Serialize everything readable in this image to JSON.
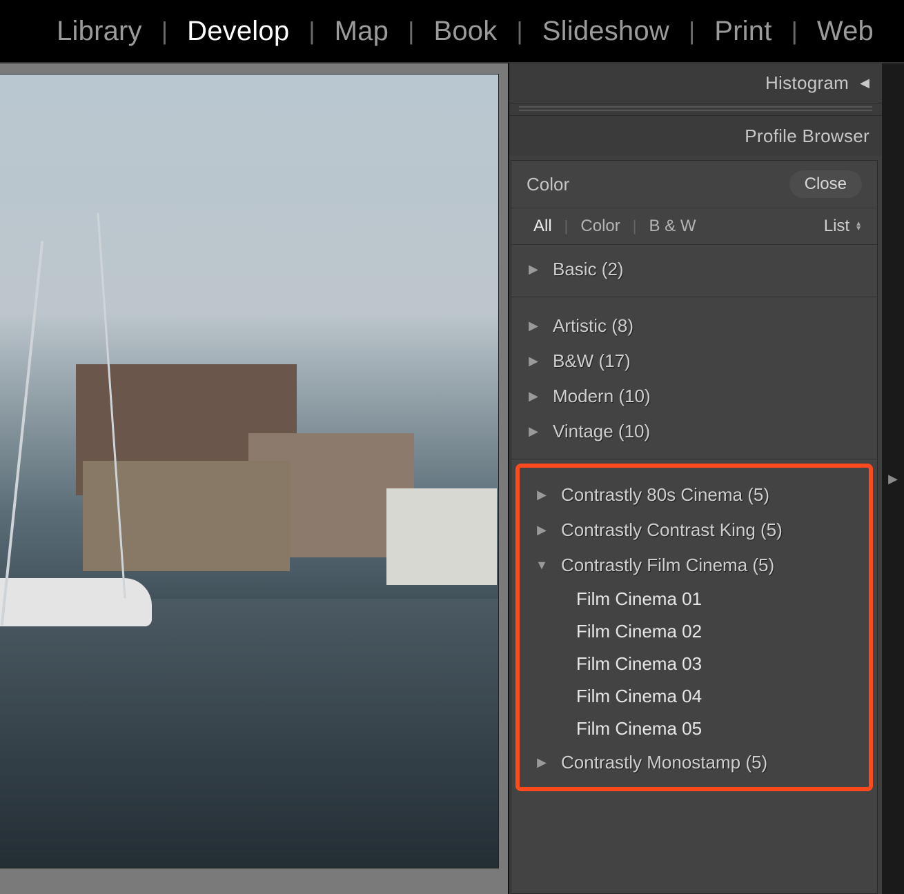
{
  "modules": {
    "items": [
      "Library",
      "Develop",
      "Map",
      "Book",
      "Slideshow",
      "Print",
      "Web"
    ],
    "active": "Develop"
  },
  "panel": {
    "histogram_label": "Histogram",
    "profile_browser_label": "Profile Browser",
    "mode_label": "Color",
    "close_label": "Close",
    "filters": {
      "all": "All",
      "color": "Color",
      "bw": "B & W",
      "active": "All"
    },
    "view_mode": "List"
  },
  "groups_a": [
    {
      "label": "Basic (2)",
      "expanded": false
    }
  ],
  "groups_b": [
    {
      "label": "Artistic (8)",
      "expanded": false
    },
    {
      "label": "B&W (17)",
      "expanded": false
    },
    {
      "label": "Modern (10)",
      "expanded": false
    },
    {
      "label": "Vintage (10)",
      "expanded": false
    }
  ],
  "groups_highlight": [
    {
      "label": "Contrastly 80s Cinema (5)",
      "expanded": false,
      "items": []
    },
    {
      "label": "Contrastly Contrast King (5)",
      "expanded": false,
      "items": []
    },
    {
      "label": "Contrastly Film Cinema (5)",
      "expanded": true,
      "items": [
        "Film Cinema 01",
        "Film Cinema 02",
        "Film Cinema 03",
        "Film Cinema 04",
        "Film Cinema 05"
      ]
    },
    {
      "label": "Contrastly Monostamp (5)",
      "expanded": false,
      "items": []
    }
  ]
}
